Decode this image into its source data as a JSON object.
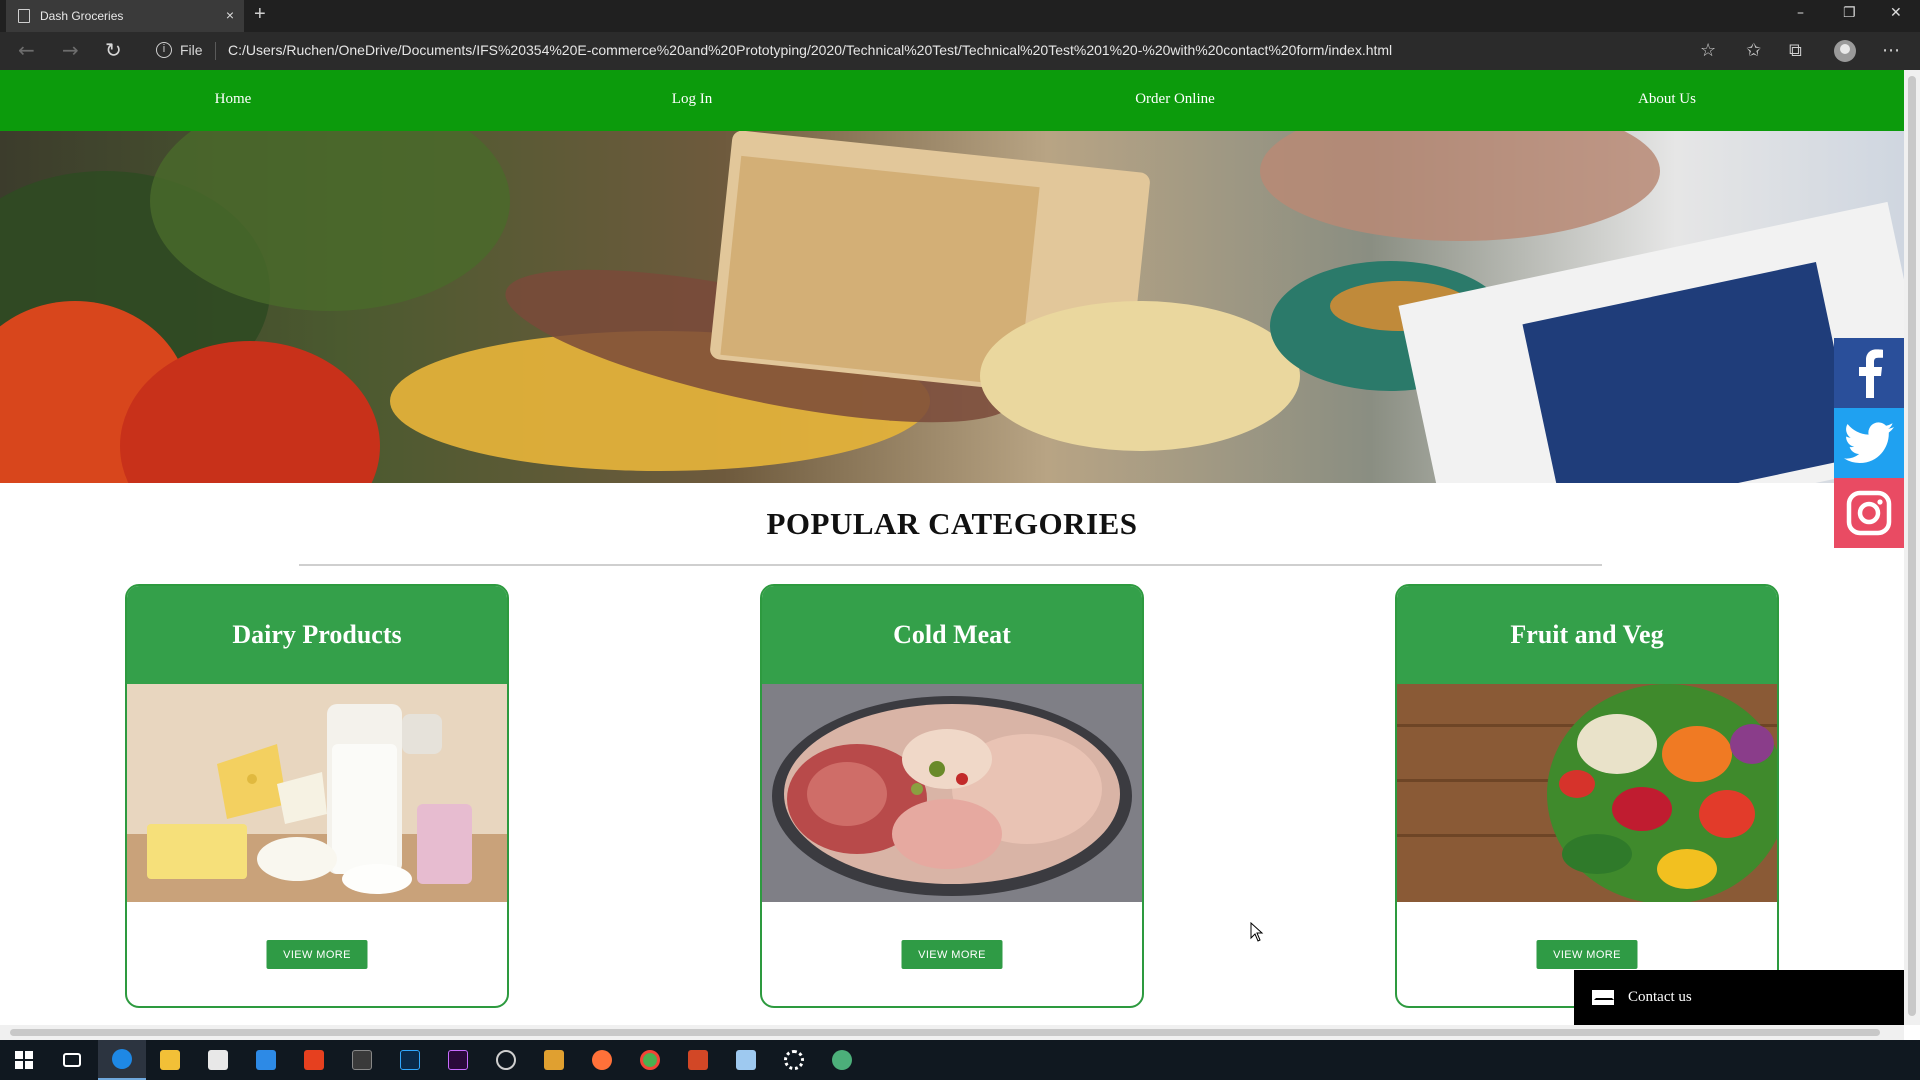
{
  "browser": {
    "tab_title": "Dash Groceries",
    "tab_close": "×",
    "new_tab": "+",
    "window_controls": {
      "minimize": "–",
      "restore": "❐",
      "close": "✕"
    },
    "nav": {
      "back": "←",
      "forward": "→",
      "refresh": "↻"
    },
    "address_info": "i",
    "address_label": "File",
    "url": "C:/Users/Ruchen/OneDrive/Documents/IFS%20354%20E-commerce%20and%20Prototyping/2020/Technical%20Test/Technical%20Test%201%20-%20with%20contact%20form/index.html",
    "toolbar_icons": {
      "favorite": "☆",
      "favorites": "✩",
      "collections": "⧉",
      "menu": "⋯"
    }
  },
  "site": {
    "nav": {
      "home": "Home",
      "login": "Log In",
      "order": "Order Online",
      "about": "About Us"
    },
    "section_title": "POPULAR CATEGORIES",
    "categories": [
      {
        "title": "Dairy Products",
        "button": "VIEW MORE"
      },
      {
        "title": "Cold Meat",
        "button": "VIEW MORE"
      },
      {
        "title": "Fruit and Veg",
        "button": "VIEW MORE"
      }
    ],
    "social": [
      "facebook",
      "twitter",
      "instagram"
    ],
    "contact_label": "Contact us"
  },
  "colors": {
    "nav_green": "#0c9b0c",
    "card_green": "#34a04a",
    "facebook": "#2a4f9a",
    "twitter": "#1fa1f1",
    "instagram": "#e94b63"
  }
}
